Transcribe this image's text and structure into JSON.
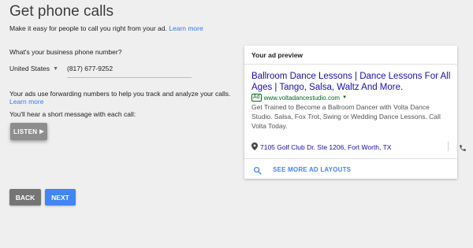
{
  "page": {
    "title": "Get phone calls",
    "description": "Make it easy for people to call you right from your ad.",
    "learn_more": "Learn more"
  },
  "phone": {
    "question": "What's your business phone number?",
    "country": "United States",
    "number": "(817) 677-9252"
  },
  "forwarding": {
    "text": "Your ads use forwarding numbers to help you track and analyze your calls.",
    "learn_more": "Learn more",
    "message_note": "You'll hear a short message with each call:",
    "listen_label": "LISTEN"
  },
  "buttons": {
    "back": "BACK",
    "next": "NEXT"
  },
  "preview": {
    "header": "Your ad preview",
    "headline": "Ballroom Dance Lessons | Dance Lessons For All Ages | Tango, Salsa, Waltz And More.",
    "badge": "Ad",
    "url": "www.voltadancestudio.com",
    "description": "Get Trained to Become a Ballroom Dancer with Volta Dance Studio. Salsa, Fox Trot, Swing or Wedding Dance Lessons. Call Volta Today.",
    "address": "7105 Golf Club Dr. Ste 1206, Fort Worth, TX",
    "more_layouts": "SEE MORE AD LAYOUTS"
  },
  "colors": {
    "accent": "#4285f4",
    "link": "#3b78e7",
    "ad_title": "#1a0dab",
    "ad_url": "#006621"
  },
  "icons": [
    "chevron-down-icon",
    "play-icon",
    "location-pin-icon",
    "phone-icon",
    "search-icon"
  ]
}
